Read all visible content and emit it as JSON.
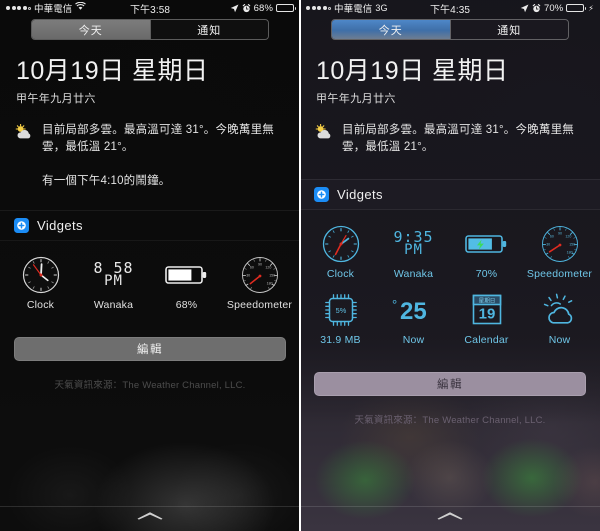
{
  "panels": [
    {
      "id": "left",
      "status": {
        "carrier": "中華電信",
        "network_icon": "wifi-icon",
        "network_label": "",
        "time": "下午3:58",
        "battery_percent": "68%",
        "battery_level": 68,
        "charging": false,
        "location_icon": "location-arrow-icon",
        "alarm_icon": "alarm-clock-icon"
      },
      "segmented": {
        "today": "今天",
        "notifications": "通知",
        "selected": "今天"
      },
      "date": {
        "main": "10月19日 星期日",
        "lunar": "甲午年九月廿六"
      },
      "weather": {
        "icon": "sun-behind-cloud-icon",
        "text": "目前局部多雲。最高溫可達 31°。今晚萬里無雲，最低溫 21°。"
      },
      "alarm": {
        "text": "有一個下午4:10的鬧鐘。",
        "visible": true
      },
      "section": {
        "icon": "vidgets-app-icon",
        "title": "Vidgets"
      },
      "widgets": [
        {
          "type": "analog-clock",
          "label": "Clock",
          "hour_deg": 358,
          "minute_deg": 20,
          "second_deg": 330
        },
        {
          "type": "digital-clock",
          "label": "Wanaka",
          "line1": "8 58",
          "line2": "PM"
        },
        {
          "type": "battery",
          "label": "68%",
          "level": 68,
          "charging": false
        },
        {
          "type": "speedometer",
          "label": "Speedometer",
          "needle_deg": 222,
          "ticks": [
            "30",
            "60",
            "90",
            "120",
            "150",
            "180"
          ]
        }
      ],
      "edit_button": "編輯",
      "footer": "天氣資訊來源：The Weather Channel, LLC."
    },
    {
      "id": "right",
      "status": {
        "carrier": "中華電信",
        "network_icon": "",
        "network_label": "3G",
        "time": "下午4:35",
        "battery_percent": "70%",
        "battery_level": 70,
        "charging": true,
        "location_icon": "location-arrow-icon",
        "alarm_icon": "alarm-clock-icon"
      },
      "segmented": {
        "today": "今天",
        "notifications": "通知",
        "selected": "今天"
      },
      "date": {
        "main": "10月19日 星期日",
        "lunar": "甲午年九月廿六"
      },
      "weather": {
        "icon": "sun-behind-cloud-icon",
        "text": "目前局部多雲。最高溫可達 31°。今晚萬里無雲，最低溫 21°。"
      },
      "alarm": {
        "text": "",
        "visible": false
      },
      "section": {
        "icon": "vidgets-app-icon",
        "title": "Vidgets"
      },
      "widgets": [
        {
          "type": "analog-clock",
          "label": "Clock",
          "hour_deg": 285,
          "minute_deg": 210,
          "second_deg": 30
        },
        {
          "type": "digital-clock",
          "label": "Wanaka",
          "line1": "9:35",
          "line2": "PM"
        },
        {
          "type": "battery",
          "label": "70%",
          "level": 70,
          "charging": true
        },
        {
          "type": "speedometer",
          "label": "Speedometer",
          "needle_deg": 232,
          "ticks": [
            "30",
            "60",
            "90",
            "120",
            "150",
            "180"
          ]
        },
        {
          "type": "cpu-chip",
          "label": "31.9 MB",
          "value": "5%"
        },
        {
          "type": "temperature",
          "label": "Now",
          "value": "25",
          "unit": "°"
        },
        {
          "type": "calendar",
          "label": "Calendar",
          "weekday": "星期日",
          "day": "19"
        },
        {
          "type": "weather-glyph",
          "label": "Now",
          "icon": "sun-behind-cloud-icon"
        }
      ],
      "edit_button": "編輯",
      "footer": "天氣資訊來源：The Weather Channel, LLC."
    }
  ],
  "colors": {
    "accent_blue": "#1b8cf5",
    "widget_cyan": "#4fb6e0",
    "label_cyan": "#6fc6e8",
    "needle_red": "#e02b20",
    "battery_green": "#4cd964",
    "edit_gray": "#6e6e6e",
    "edit_mauve": "#9b8fa0"
  }
}
